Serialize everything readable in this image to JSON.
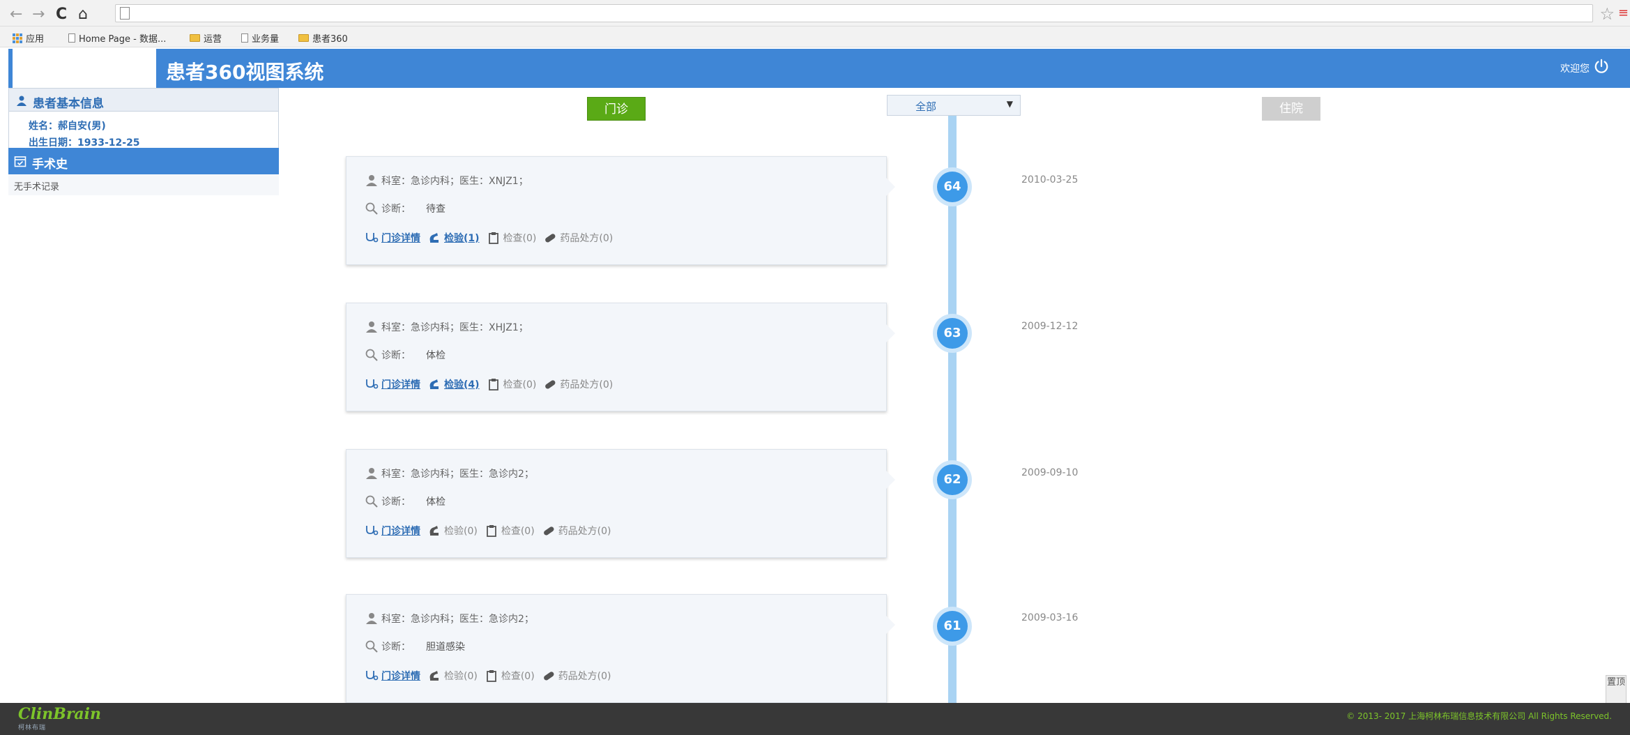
{
  "browser": {
    "bookmarks": [
      "应用",
      "Home Page - 数据...",
      "运营",
      "业务量",
      "患者360"
    ]
  },
  "header": {
    "title": "患者360视图系统",
    "welcome": "欢迎您"
  },
  "sidebar": {
    "basic_info_title": "患者基本信息",
    "name_line": "姓名：郝自安(男)",
    "dob_line": "出生日期：1933-12-25",
    "surgery_title": "手术史",
    "surgery_empty": "无手术记录"
  },
  "controls": {
    "outpatient_label": "门诊",
    "filter_value": "全部",
    "inpatient_label": "住院"
  },
  "timeline": [
    {
      "num": "64",
      "date": "2010-03-25",
      "dept_line": "科室：急诊内科；医生：XNJZ1；",
      "diag_label": "诊断：",
      "diag_value": "待查",
      "detail": "门诊详情",
      "lab": "检验(1)",
      "exam": "检查(0)",
      "drug": "药品处方(0)"
    },
    {
      "num": "63",
      "date": "2009-12-12",
      "dept_line": "科室：急诊内科；医生：XHJZ1；",
      "diag_label": "诊断：",
      "diag_value": "体检",
      "detail": "门诊详情",
      "lab": "检验(4)",
      "exam": "检查(0)",
      "drug": "药品处方(0)"
    },
    {
      "num": "62",
      "date": "2009-09-10",
      "dept_line": "科室：急诊内科；医生：急诊内2；",
      "diag_label": "诊断：",
      "diag_value": "体检",
      "detail": "门诊详情",
      "lab": "检验(0)",
      "exam": "检查(0)",
      "drug": "药品处方(0)"
    },
    {
      "num": "61",
      "date": "2009-03-16",
      "dept_line": "科室：急诊内科；医生：急诊内2；",
      "diag_label": "诊断：",
      "diag_value": "胆道感染",
      "detail": "门诊详情",
      "lab": "检验(0)",
      "exam": "检查(0)",
      "drug": "药品处方(0)"
    }
  ],
  "side_tab": "置顶",
  "footer": {
    "brand": "ClinBrain",
    "brand_sub": "柯林布瑞",
    "copyright": "© 2013- 2017 上海柯林布瑞信息技术有限公司 All Rights Reserved."
  },
  "colors": {
    "header_blue": "#3f86d6",
    "outpatient_green": "#5aaa16",
    "timeline_blue": "#3d9ae8",
    "brand_green": "#7dc42a"
  }
}
